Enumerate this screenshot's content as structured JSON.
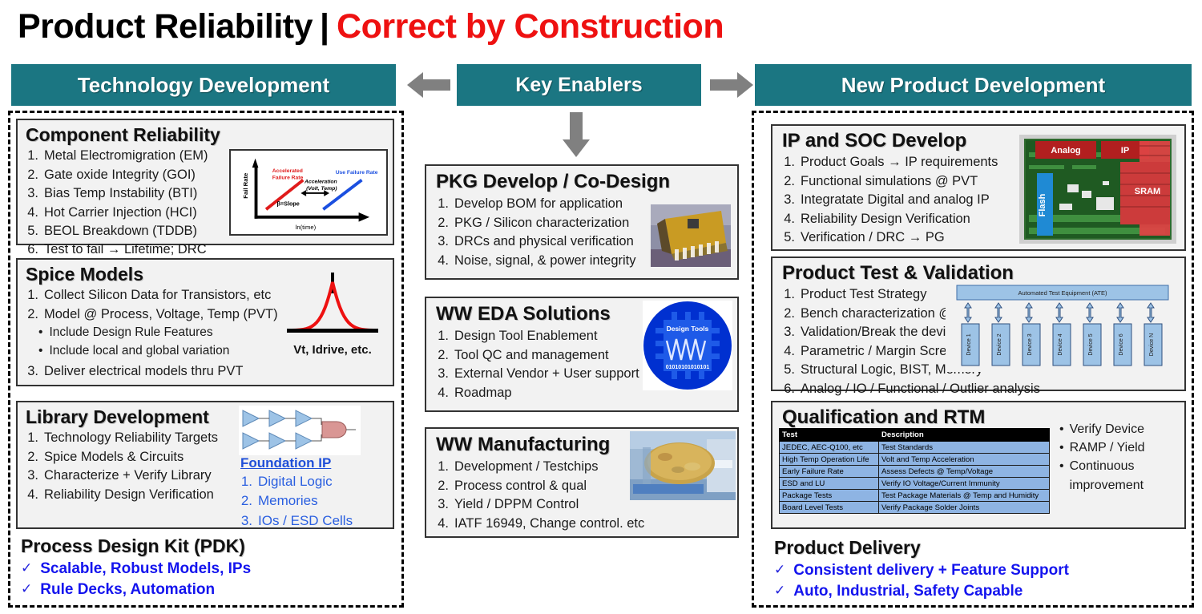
{
  "title": {
    "main": "Product Reliability",
    "separator": "|",
    "accent": "Correct by Construction"
  },
  "headers": {
    "technology": "Technology Development",
    "key_enablers": "Key Enablers",
    "new_product": "New Product Development",
    "arrow_left": "arrow-left-icon",
    "arrow_right": "arrow-right-icon",
    "arrow_down": "arrow-down-icon"
  },
  "colors": {
    "teal": "#1B7682",
    "accent_red": "#EE1111",
    "blue_text": "#1414EE",
    "link_blue": "#2A5FE0",
    "table_row": "#8EB4E3",
    "arrow_gray": "#808080"
  },
  "left_column": {
    "panels": [
      {
        "title": "Component Reliability",
        "items": [
          "Metal Electromigration (EM)",
          "Gate oxide Integrity (GOI)",
          "Bias Temp Instability (BTI)",
          "Hot Carrier Injection (HCI)",
          "BEOL Breakdown (TDDB)",
          "Test to fail → Lifetime; DRC"
        ],
        "figure": {
          "name": "fail-rate-chart",
          "ylabel": "Fail Rate",
          "xlabel": "ln(time)",
          "labels": [
            "Accelerated Failure Rate",
            "Acceleration (Volt, Temp)",
            "Use Failure Rate",
            "β=Slope"
          ]
        }
      },
      {
        "title": "Spice Models",
        "items": [
          "Collect Silicon Data for Transistors, etc",
          "Model @ Process, Voltage, Temp (PVT)"
        ],
        "subitems": [
          "Include Design Rule Features",
          "Include local and global variation"
        ],
        "item3": "Deliver electrical models thru PVT",
        "figure": {
          "name": "gaussian-distribution-chart",
          "caption": "Vt, Idrive, etc."
        }
      },
      {
        "title": "Library Development",
        "items": [
          "Technology Reliability Targets",
          "Spice Models & Circuits",
          "Characterize + Verify Library",
          "Reliability Design Verification"
        ],
        "figure": {
          "name": "buffer-chain-diagram"
        },
        "foundation_ip": {
          "title": "Foundation IP",
          "items": [
            "Digital Logic",
            "Memories",
            "IOs / ESD Cells"
          ]
        }
      }
    ],
    "pdk": {
      "title": "Process Design Kit (PDK)",
      "check": "✓",
      "items": [
        "Scalable, Robust Models, IPs",
        "Rule Decks, Automation"
      ]
    }
  },
  "middle_column": {
    "panels": [
      {
        "title": "PKG Develop / Co-Design",
        "items": [
          "Develop BOM for application",
          "PKG / Silicon characterization",
          "DRCs and physical verification",
          "Noise, signal, & power integrity"
        ],
        "figure": {
          "name": "package-photo"
        }
      },
      {
        "title": "WW EDA Solutions",
        "items": [
          "Design Tool Enablement",
          "Tool QC and management",
          "External Vendor + User support",
          "Roadmap"
        ],
        "figure": {
          "name": "design-tools-chip-icon",
          "label": "Design Tools",
          "bits": "01010101010101"
        }
      },
      {
        "title": "WW Manufacturing",
        "items": [
          "Development / Testchips",
          "Process control & qual",
          "Yield / DPPM  Control",
          "IATF 16949, Change control. etc"
        ],
        "figure": {
          "name": "wafer-photo"
        }
      }
    ]
  },
  "right_column": {
    "panels": [
      {
        "title": "IP and SOC Develop",
        "items": [
          "Product Goals → IP requirements",
          "Functional simulations @ PVT",
          "Integratate Digital and analog IP",
          "Reliability Design Verification",
          "Verification / DRC → PG"
        ],
        "figure": {
          "name": "soc-die-floorplan",
          "blocks": [
            "Analog",
            "IP",
            "SRAM",
            "Flash"
          ]
        }
      },
      {
        "title": "Product Test  & Validation",
        "items": [
          "Product Test Strategy",
          "Bench characterization @  PVT",
          "Validation/Break the device tests",
          "Parametric / Margin Screens",
          "Structural Logic, BIST, Memory",
          "Analog / IO / Functional / Outlier analysis"
        ],
        "figure": {
          "name": "ate-diagram",
          "header": "Automated Test Equipment (ATE)",
          "devices": [
            "Device 1",
            "Device 2",
            "Device 3",
            "Device 4",
            "Device 5",
            "Device 6",
            "Device N"
          ]
        }
      },
      {
        "title": "Qualification and RTM",
        "table": {
          "headers": [
            "Test",
            "Description"
          ],
          "rows": [
            [
              "JEDEC, AEC-Q100, etc",
              "Test Standards"
            ],
            [
              "High Temp Operation Life",
              "Volt and Temp Acceleration"
            ],
            [
              "Early Failure Rate",
              "Assess Defects @ Temp/Voltage"
            ],
            [
              "ESD and LU",
              "Verify IO Voltage/Current Immunity"
            ],
            [
              "Package Tests",
              "Test Package Materials @ Temp and Humidity"
            ],
            [
              "Board Level Tests",
              "Verify Package Solder Joints"
            ]
          ]
        },
        "bullets": [
          "Verify Device",
          "RAMP / Yield",
          "Continuous improvement"
        ]
      }
    ],
    "delivery": {
      "title": "Product Delivery",
      "check": "✓",
      "items": [
        "Consistent delivery + Feature Support",
        "Auto, Industrial, Safety Capable"
      ]
    }
  }
}
